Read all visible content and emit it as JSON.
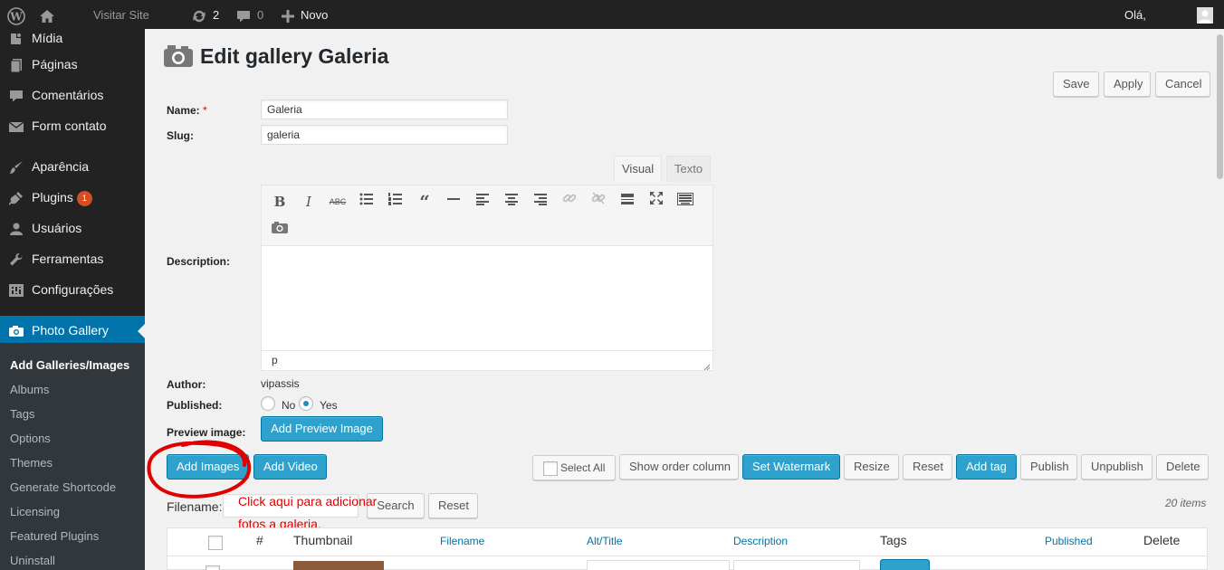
{
  "adminbar": {
    "visit_site": "Visitar Site",
    "updates_count": "2",
    "comments_count": "0",
    "new_label": "Novo",
    "greeting": "Olá,"
  },
  "sidebar": {
    "items": [
      {
        "label": "Mídia",
        "icon": "media-icon"
      },
      {
        "label": "Páginas",
        "icon": "pages-icon"
      },
      {
        "label": "Comentários",
        "icon": "comments-icon"
      },
      {
        "label": "Form contato",
        "icon": "mail-icon"
      },
      {
        "label": "Aparência",
        "icon": "brush-icon"
      },
      {
        "label": "Plugins",
        "icon": "plugin-icon",
        "badge": "1"
      },
      {
        "label": "Usuários",
        "icon": "users-icon"
      },
      {
        "label": "Ferramentas",
        "icon": "wrench-icon"
      },
      {
        "label": "Configurações",
        "icon": "settings-icon"
      },
      {
        "label": "Photo Gallery",
        "icon": "camera-icon"
      }
    ],
    "submenu": [
      "Add Galleries/Images",
      "Albums",
      "Tags",
      "Options",
      "Themes",
      "Generate Shortcode",
      "Licensing",
      "Featured Plugins",
      "Uninstall"
    ]
  },
  "page": {
    "title": "Edit gallery Galeria",
    "buttons": {
      "save": "Save",
      "apply": "Apply",
      "cancel": "Cancel"
    }
  },
  "form": {
    "name_label": "Name:",
    "name_required": "*",
    "name_value": "Galeria",
    "slug_label": "Slug:",
    "slug_value": "galeria",
    "description_label": "Description:",
    "tab_visual": "Visual",
    "tab_text": "Texto",
    "editor_path": "p",
    "author_label": "Author:",
    "author_value": "vipassis",
    "published_label": "Published:",
    "published_no": "No",
    "published_yes": "Yes",
    "published_selected": "Yes",
    "preview_label": "Preview image:",
    "preview_button": "Add Preview Image"
  },
  "actions": {
    "add_images": "Add Images",
    "add_video": "Add Video",
    "select_all": "Select All",
    "show_order_column": "Show order column",
    "set_watermark": "Set Watermark",
    "resize": "Resize",
    "reset": "Reset",
    "add_tag": "Add tag",
    "publish": "Publish",
    "unpublish": "Unpublish",
    "delete": "Delete"
  },
  "filter": {
    "label": "Filename:",
    "search": "Search",
    "reset": "Reset",
    "count": "20 items"
  },
  "annotation": {
    "line1": "Click aqui para adicionar",
    "line2": "fotos a galeria.",
    "color": "#e00000"
  },
  "table": {
    "headers": {
      "order": "#",
      "thumbnail": "Thumbnail",
      "filename": "Filename",
      "alt": "Alt/Title",
      "description": "Description",
      "tags": "Tags",
      "published": "Published",
      "delete": "Delete"
    }
  },
  "colors": {
    "adminbar": "#222222",
    "sidebar": "#222222",
    "submenu": "#32373c",
    "accent": "#0073aa",
    "primary_button": "#2ea2cc",
    "background": "#f1f1f1"
  }
}
